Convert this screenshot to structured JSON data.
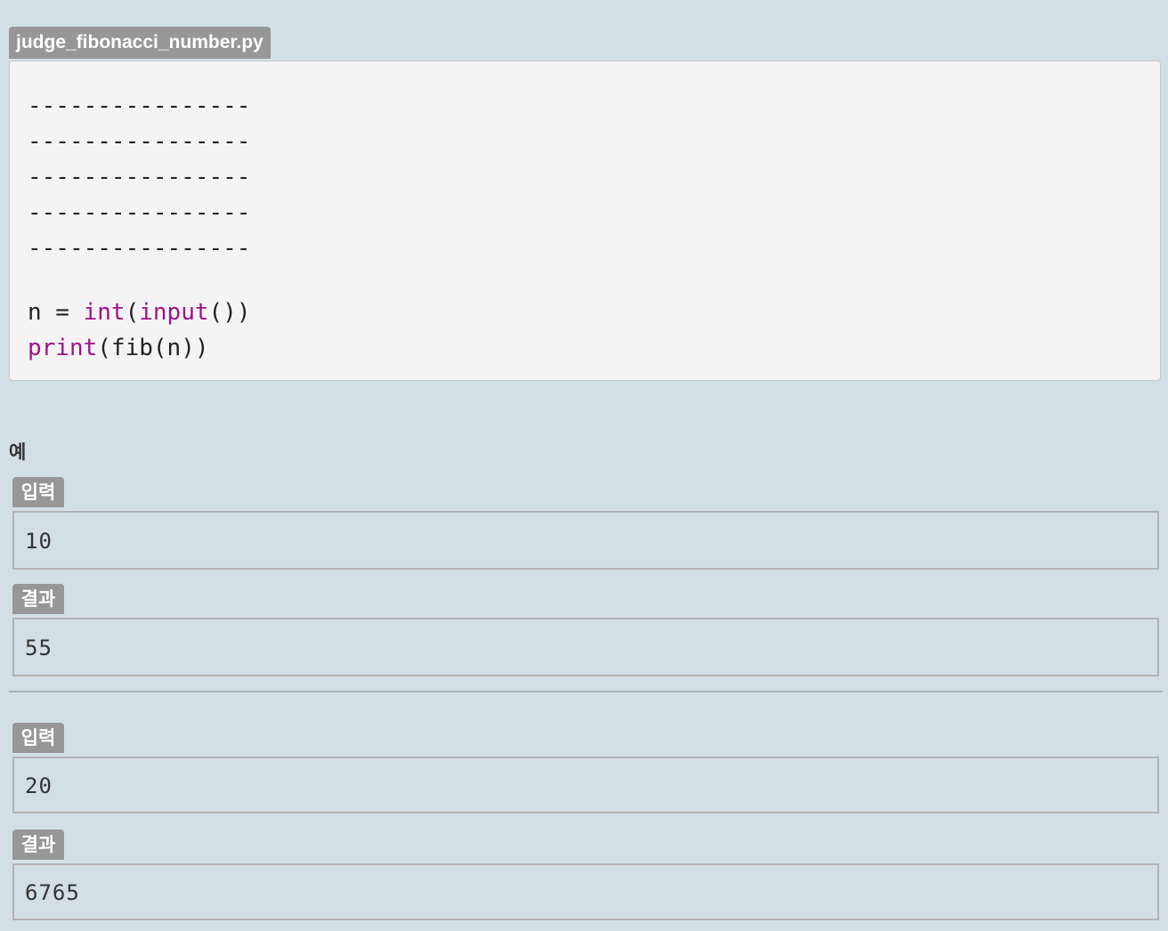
{
  "file": {
    "name": "judge_fibonacci_number.py"
  },
  "code": {
    "blank_lines": [
      "----------------",
      "----------------",
      "----------------",
      "----------------",
      "----------------"
    ],
    "line1": {
      "var": "n = ",
      "func1": "int",
      "open1": "(",
      "func2": "input",
      "rest": "())"
    },
    "line2": {
      "func": "print",
      "rest": "(fib(n))"
    }
  },
  "examples": {
    "title": "예",
    "items": [
      {
        "input_label": "입력",
        "input_value": "10",
        "output_label": "결과",
        "output_value": "55"
      },
      {
        "input_label": "입력",
        "input_value": "20",
        "output_label": "결과",
        "output_value": "6765"
      }
    ]
  },
  "colors": {
    "background": "#d2e0e5",
    "label_bg": "#979797",
    "keyword": "#a0138a",
    "code_bg": "#f4f4f4"
  }
}
